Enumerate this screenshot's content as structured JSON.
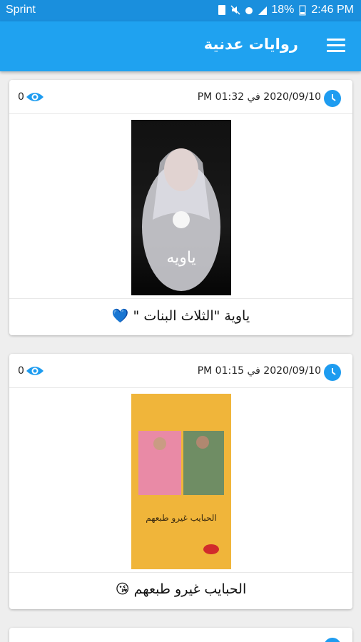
{
  "status_bar": {
    "carrier": "Sprint",
    "battery": "18%",
    "time": "2:46 PM"
  },
  "app_bar": {
    "title": "روايات عدنية"
  },
  "posts": [
    {
      "views": "0",
      "date": "2020/09/10 في 01:32 PM",
      "title": "ياوية \"الثلاث البنات \" 💙",
      "cover_text": "ياويه"
    },
    {
      "views": "0",
      "date": "2020/09/10 في 01:15 PM",
      "title": "الحبايب غيرو طبعهم 😘",
      "cover_text": "الحبايب غيرو طبعهم"
    }
  ],
  "colors": {
    "app_bar": "#1fa2f0",
    "status_bar": "#1a8fdd",
    "accent_icon": "#1e9cf0"
  }
}
